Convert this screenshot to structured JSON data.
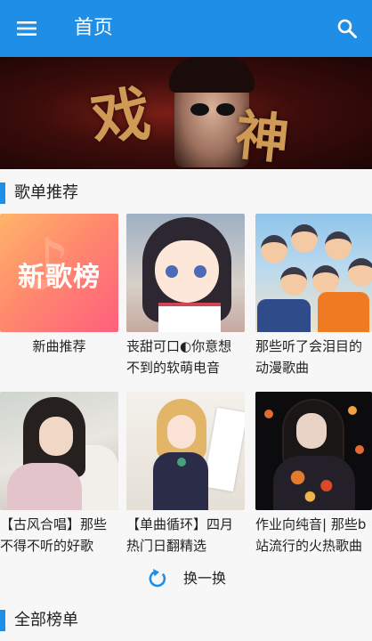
{
  "appbar": {
    "title": "首页",
    "menu_icon": "menu-icon",
    "search_icon": "search-icon",
    "color": "#1e8ee6"
  },
  "banner": {
    "glyph_left": "戏",
    "glyph_right": "神"
  },
  "sections": {
    "playlists_title": "歌单推荐",
    "all_charts_title": "全部榜单",
    "accent_color": "#1e8ee6"
  },
  "playlists": [
    {
      "cover_text": "新歌榜",
      "title": "新曲推荐"
    },
    {
      "title": "丧甜可口◐你意想不到的软萌电音"
    },
    {
      "title": "那些听了会泪目的动漫歌曲"
    },
    {
      "title": "【古风合唱】那些不得不听的好歌"
    },
    {
      "title": "【单曲循环】四月热门日翻精选"
    },
    {
      "title": "作业向纯音| 那些b站流行的火热歌曲"
    }
  ],
  "refresh": {
    "label": "换一换",
    "icon": "refresh-icon"
  }
}
